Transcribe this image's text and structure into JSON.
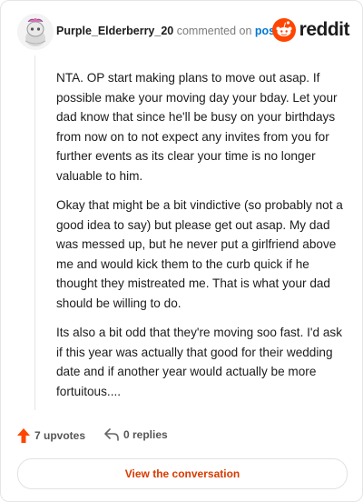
{
  "comment": {
    "username": "Purple_Elderberry_20",
    "action_text": "commented on",
    "post_link_text": "post",
    "paragraphs": [
      "NTA. OP start making plans to move out asap. If possible make your moving day your bday. Let your dad know that since he'll be busy on your birthdays from now on to not expect any invites from you for further events as its clear your time is no longer valuable to him.",
      "Okay that might be a bit vindictive (so probably not a good idea to say) but please get out asap. My dad was messed up, but he never put a girlfriend above me and would kick them to the curb quick if he thought they mistreated me. That is what your dad should be willing to do.",
      "Its also a bit odd that they're moving soo fast. I'd ask if this year was actually that good for their wedding date and if another year would actually be more fortuitous...."
    ]
  },
  "brand": {
    "wordmark": "reddit",
    "accent_color": "#ff4500"
  },
  "stats": {
    "upvotes_label": "7 upvotes",
    "replies_label": "0 replies"
  },
  "cta": {
    "label": "View the conversation",
    "color": "#d93a00"
  }
}
